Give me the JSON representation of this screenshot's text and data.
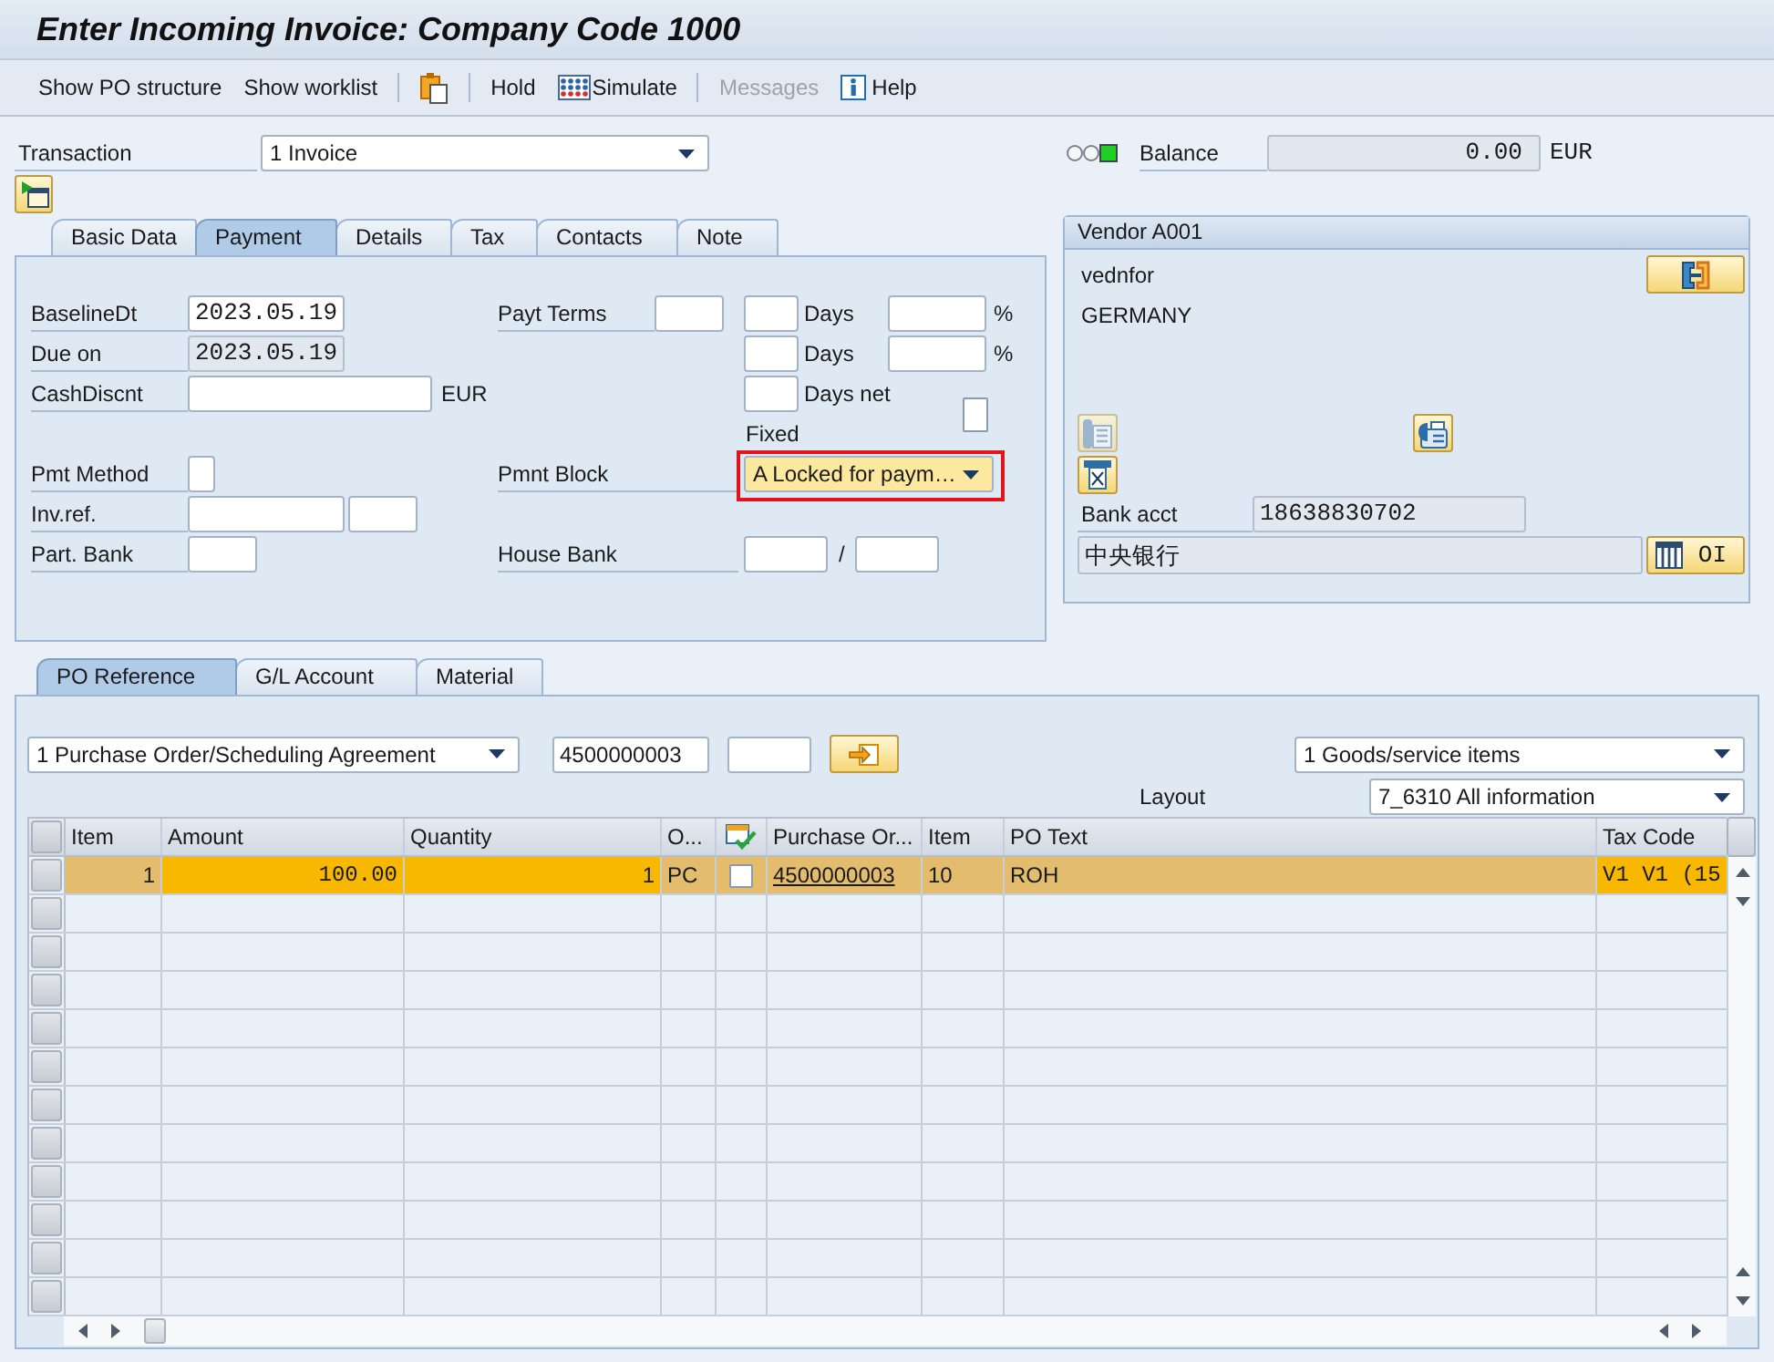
{
  "window": {
    "title": "Enter Incoming Invoice: Company Code 1000"
  },
  "toolbar": [
    {
      "kind": "text",
      "label": "Show PO structure",
      "disabled": false
    },
    {
      "kind": "text",
      "label": "Show worklist",
      "disabled": false
    },
    {
      "kind": "separator"
    },
    {
      "kind": "clipboard",
      "disabled": false
    },
    {
      "kind": "separator"
    },
    {
      "kind": "text",
      "label": "Hold",
      "disabled": false
    },
    {
      "kind": "simulate",
      "label": "Simulate",
      "disabled": false
    },
    {
      "kind": "separator"
    },
    {
      "kind": "text",
      "label": "Messages",
      "disabled": true
    },
    {
      "kind": "help",
      "label": "Help",
      "disabled": false
    }
  ],
  "transaction": {
    "label": "Transaction",
    "value": "1 Invoice"
  },
  "balance": {
    "lights": [
      {
        "on": false
      },
      {
        "on": false
      },
      {
        "on": true
      }
    ],
    "label": "Balance",
    "value": "0.00",
    "currency": "EUR"
  },
  "header_tabs": [
    {
      "label": "Basic Data",
      "selected": false
    },
    {
      "label": "Payment",
      "selected": true
    },
    {
      "label": "Details",
      "selected": false
    },
    {
      "label": "Tax",
      "selected": false
    },
    {
      "label": "Contacts",
      "selected": false
    },
    {
      "label": "Note",
      "selected": false
    }
  ],
  "payment": {
    "baseline_date": {
      "label": "BaselineDt",
      "value": "2023.05.19",
      "disabled": false
    },
    "due_on": {
      "label": "Due on",
      "value": "2023.05.19",
      "disabled": true
    },
    "cash_discount": {
      "label": "CashDiscnt",
      "disabled": false,
      "currency": "EUR"
    },
    "payment_method": {
      "label": "Pmt Method",
      "disabled": false
    },
    "invoice_reference": {
      "label": "Inv.ref.",
      "fields": [
        {
          "disabled": false
        },
        {
          "disabled": false
        }
      ]
    },
    "partner_bank": {
      "label": "Part. Bank",
      "disabled": false
    },
    "payment_terms": {
      "label": "Payt Terms",
      "disabled": false
    },
    "terms_lines": [
      {
        "days": {
          "disabled": false
        },
        "days_label": "Days",
        "percent": {
          "disabled": false
        },
        "percent_label": "%"
      },
      {
        "days": {
          "disabled": false
        },
        "days_label": "Days",
        "percent": {
          "disabled": false
        },
        "percent_label": "%"
      },
      {
        "days": {
          "disabled": false
        },
        "days_label": "Days net"
      }
    ],
    "fixed": {
      "label": "Fixed",
      "checked": false
    },
    "payment_block": {
      "label": "Pmnt Block",
      "value": "A Locked for paym…",
      "focused": true,
      "highlighted": true
    },
    "house_bank": {
      "label": "House Bank",
      "fields": [
        {
          "disabled": false
        },
        {
          "disabled": false
        }
      ],
      "separator": "/"
    }
  },
  "vendor": {
    "title": "Vendor A001",
    "name": "vednfor",
    "country": "GERMANY",
    "buttons": [
      {
        "kind": "bracket",
        "disabled": false
      },
      {
        "kind": "telephone",
        "disabled": true
      },
      {
        "kind": "fax",
        "disabled": false
      },
      {
        "kind": "crossed_page",
        "disabled": false
      }
    ],
    "bank_account": {
      "label": "Bank acct",
      "value": "18638830702",
      "disabled": true
    },
    "bank_name": {
      "value": "中央银行",
      "disabled": true
    },
    "open_items_button": "OI"
  },
  "item_tabs": [
    {
      "label": "PO Reference",
      "selected": true
    },
    {
      "label": "G/L Account",
      "selected": false
    },
    {
      "label": "Material",
      "selected": false
    }
  ],
  "reference": {
    "document_type": "1 Purchase Order/Scheduling Agreement",
    "document_number": "4500000003",
    "document_item": {
      "disabled": false
    },
    "list_type": "1 Goods/service items",
    "layout_label": "Layout",
    "layout": "7_6310 All information"
  },
  "table": {
    "columns": [
      {
        "label": "Item",
        "kind": "number",
        "input": false
      },
      {
        "label": "Amount",
        "kind": "amount",
        "input": true
      },
      {
        "label": "Quantity",
        "kind": "number",
        "input": true
      },
      {
        "label": "O...",
        "kind": "text",
        "input": false
      },
      {
        "kind": "checkbox",
        "input": false
      },
      {
        "label": "Purchase Or...",
        "kind": "link",
        "input": false
      },
      {
        "label": "Item",
        "kind": "text",
        "input": false
      },
      {
        "label": "PO Text",
        "kind": "text",
        "input": false
      },
      {
        "label": "Tax Code",
        "kind": "code",
        "input": true
      }
    ],
    "rows": [
      {
        "selected": true,
        "cells": [
          {
            "text": "1"
          },
          {
            "text": "100.00"
          },
          {
            "text": "1"
          },
          {
            "text": "PC"
          },
          {
            "checked": false
          },
          {
            "text": "4500000003"
          },
          {
            "text": "10"
          },
          {
            "text": "ROH"
          },
          {
            "text": "V1 V1 (15"
          }
        ]
      }
    ]
  }
}
